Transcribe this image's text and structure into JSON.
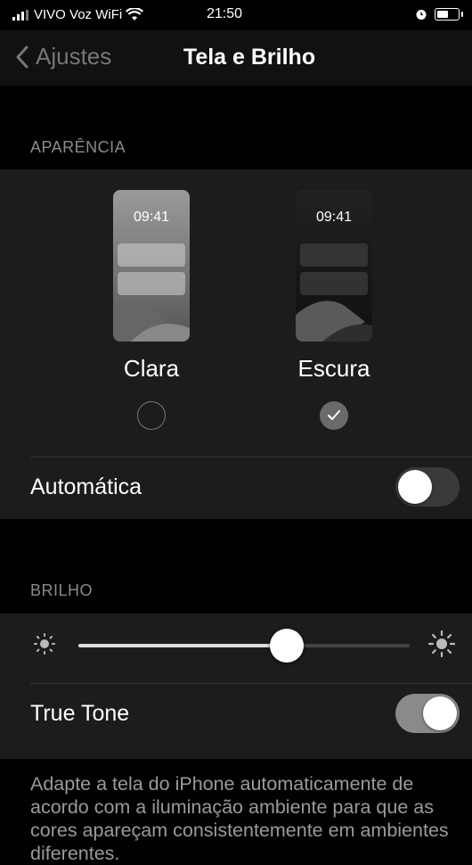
{
  "status_bar": {
    "carrier": "VIVO Voz WiFi",
    "time": "21:50",
    "icons": [
      "signal-icon",
      "wifi-icon",
      "alarm-icon",
      "battery-icon"
    ]
  },
  "nav": {
    "back_label": "Ajustes",
    "title": "Tela e Brilho"
  },
  "appearance": {
    "header": "APARÊNCIA",
    "options": [
      {
        "clock": "09:41",
        "label": "Clara",
        "selected": false
      },
      {
        "clock": "09:41",
        "label": "Escura",
        "selected": true
      }
    ],
    "automatic_label": "Automática",
    "automatic_on": false
  },
  "brightness": {
    "header": "BRILHO",
    "level": 0.63,
    "true_tone_label": "True Tone",
    "true_tone_on": true,
    "footer": "Adapte a tela do iPhone automaticamente de acordo com a iluminação ambiente para que as cores apareçam consistentemente em ambientes diferentes."
  },
  "colors": {
    "background": "#000000",
    "group_background": "#1c1c1c",
    "secondary_text": "#8a8a8a",
    "toggle_on": "#8a8a8a"
  }
}
